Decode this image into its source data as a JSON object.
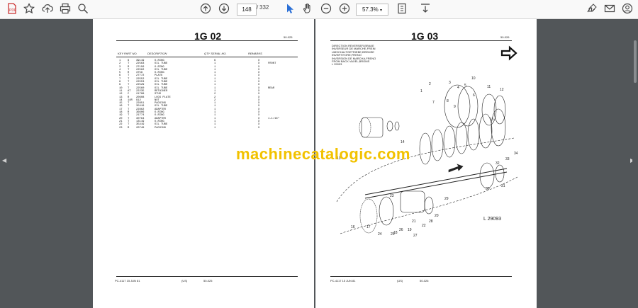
{
  "toolbar": {
    "page_current": "148",
    "page_separator": "/",
    "page_total": "332",
    "zoom": "57.3%",
    "icons": [
      "create-pdf-icon",
      "bookmark-star-icon",
      "upload-cloud-icon",
      "print-icon",
      "zoom-search-icon",
      "page-up-icon",
      "page-down-icon",
      "select-cursor-icon",
      "hand-pan-icon",
      "zoom-out-icon",
      "zoom-in-icon",
      "page-fit-icon",
      "download-icon",
      "sign-icon",
      "email-icon",
      "account-icon"
    ]
  },
  "left_page": {
    "title": "1G 02",
    "code": "50-025",
    "columns": [
      "KEY PART NO.",
      "DESCRIPTION",
      "QTY SERIAL NO.",
      "REMARKS"
    ],
    "rows": [
      [
        "1",
        "6",
        "39119",
        "O-RING",
        "6",
        "X",
        ""
      ],
      [
        "2",
        "T",
        "22563",
        "OIL TUBE",
        "1",
        "X",
        "FRONT"
      ],
      [
        "3",
        "R",
        "27156",
        "O-RING",
        "1",
        "X",
        ""
      ],
      [
        "4",
        "T",
        "22562",
        "OIL TUBE",
        "1",
        "X",
        ""
      ],
      [
        "5",
        "R",
        "3759",
        "O-RING",
        "1",
        "X",
        ""
      ],
      [
        "6",
        "T",
        "27772",
        "PLATE",
        "1",
        "X",
        ""
      ],
      [
        "7",
        "T",
        "22552",
        "OIL TUBE",
        "1",
        "X",
        ""
      ],
      [
        "8",
        "T",
        "22553",
        "OIL TUBE",
        "1",
        "X",
        ""
      ],
      [
        "9",
        "T",
        "22529",
        "OIL TUBE",
        "1",
        "X",
        ""
      ],
      [
        "10",
        "T",
        "22560",
        "OIL TUBE",
        "1",
        "X",
        "REAR"
      ],
      [
        "11",
        "AT",
        "22235",
        "RETAINER",
        "1",
        "X",
        ""
      ],
      [
        "12",
        "C",
        "21798",
        "STUD",
        "2",
        "X",
        ""
      ],
      [
        "13",
        "R",
        "20608",
        "LOCK PLATE",
        "2",
        "X",
        ""
      ],
      [
        "14",
        "14R",
        "912",
        "NUT",
        "2",
        "X",
        ""
      ],
      [
        "15",
        "T",
        "22851",
        "PACKING",
        "1",
        "X",
        ""
      ],
      [
        "16",
        "T",
        "35419",
        "OIL TUBE",
        "1",
        "X",
        ""
      ],
      [
        "17",
        "T",
        "22862",
        "ADAPTER",
        "1",
        "X",
        ""
      ],
      [
        "18",
        "R",
        "36606",
        "O-RING",
        "1",
        "X",
        ""
      ],
      [
        "19",
        "T",
        "21774",
        "O-RING",
        "1",
        "X",
        ""
      ],
      [
        "20",
        "T",
        "30764",
        "ADAPTER",
        "1",
        "X",
        "1-1/16\""
      ],
      [
        "21",
        "T",
        "13119",
        "O-RING",
        "1",
        "X",
        ""
      ],
      [
        "22",
        "T",
        "35419",
        "OIL TUBE",
        "1",
        "X",
        ""
      ],
      [
        "23",
        "R",
        "20749",
        "PACKING",
        "1",
        "X",
        ""
      ]
    ],
    "footer_left": "PC-4117  15 JUN 81",
    "footer_mid": "(US)",
    "footer_right": "50-025"
  },
  "right_page": {
    "title": "1G 03",
    "code": "50-026",
    "caption_lines": [
      "DIRECTION REVERSER,BRAKE",
      "INVERSEUR DE MARCHE,FREIN",
      "UMSCHALTGETRIEBE,BREMSE",
      "INVERTITORE,FRENO",
      "INVERSION DE MARCHA,FRENO",
      "FROM BACK VAXEL,BROMS",
      "L 29093"
    ],
    "part_numbers": [
      "1",
      "2",
      "3",
      "4",
      "5",
      "6",
      "7",
      "8",
      "9",
      "10",
      "11",
      "12",
      "13",
      "14",
      "15",
      "16",
      "17",
      "18",
      "19",
      "20",
      "21",
      "22",
      "23",
      "24",
      "25",
      "26",
      "27",
      "28",
      "29",
      "30",
      "31",
      "32",
      "33",
      "34"
    ],
    "ref": "L 29093",
    "footer_left": "PC-4117  15 JUN 81",
    "footer_mid": "(US)",
    "footer_right": "50-026"
  },
  "watermark": "machinecatalogic.com"
}
